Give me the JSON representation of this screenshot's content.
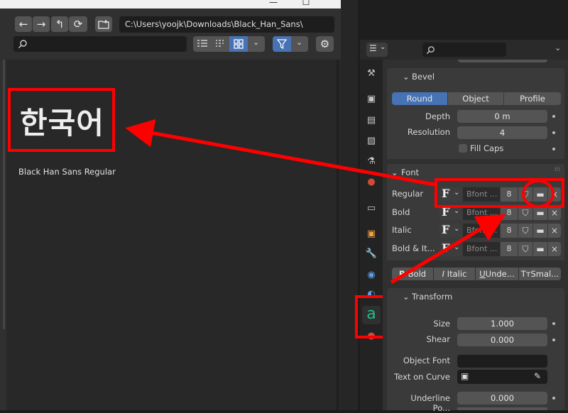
{
  "file_browser": {
    "path": "C:\\Users\\yoojk\\Downloads\\Black_Han_Sans\\",
    "font_preview": "한국어",
    "font_name": "Black Han Sans Regular"
  },
  "properties": {
    "bevel": {
      "title": "Bevel",
      "modes": [
        "Round",
        "Object",
        "Profile"
      ],
      "selected_mode": "Round",
      "depth_label": "Depth",
      "depth_value": "0 m",
      "resolution_label": "Resolution",
      "resolution_value": "4",
      "fill_caps_label": "Fill Caps"
    },
    "font": {
      "title": "Font",
      "rows": [
        {
          "label": "Regular",
          "font": "Bfont ...",
          "users": "8"
        },
        {
          "label": "Bold",
          "font": "Bfont ...",
          "users": "8"
        },
        {
          "label": "Italic",
          "font": "Bfont ...",
          "users": "8"
        },
        {
          "label": "Bold & It...",
          "font": "Bfont ...",
          "users": "8"
        }
      ],
      "styles": [
        "Bold",
        "Italic",
        "Unde...",
        "Smal..."
      ]
    },
    "transform": {
      "title": "Transform",
      "size_label": "Size",
      "size_value": "1.000",
      "shear_label": "Shear",
      "shear_value": "0.000",
      "object_font_label": "Object Font",
      "text_on_curve_label": "Text on Curve",
      "underline_pos_label": "Underline Po...",
      "underline_pos_value": "0.000"
    }
  },
  "colors": {
    "accent": "#4772b3",
    "annotation": "#ff0000",
    "active_tab": "#1fbf8f"
  }
}
